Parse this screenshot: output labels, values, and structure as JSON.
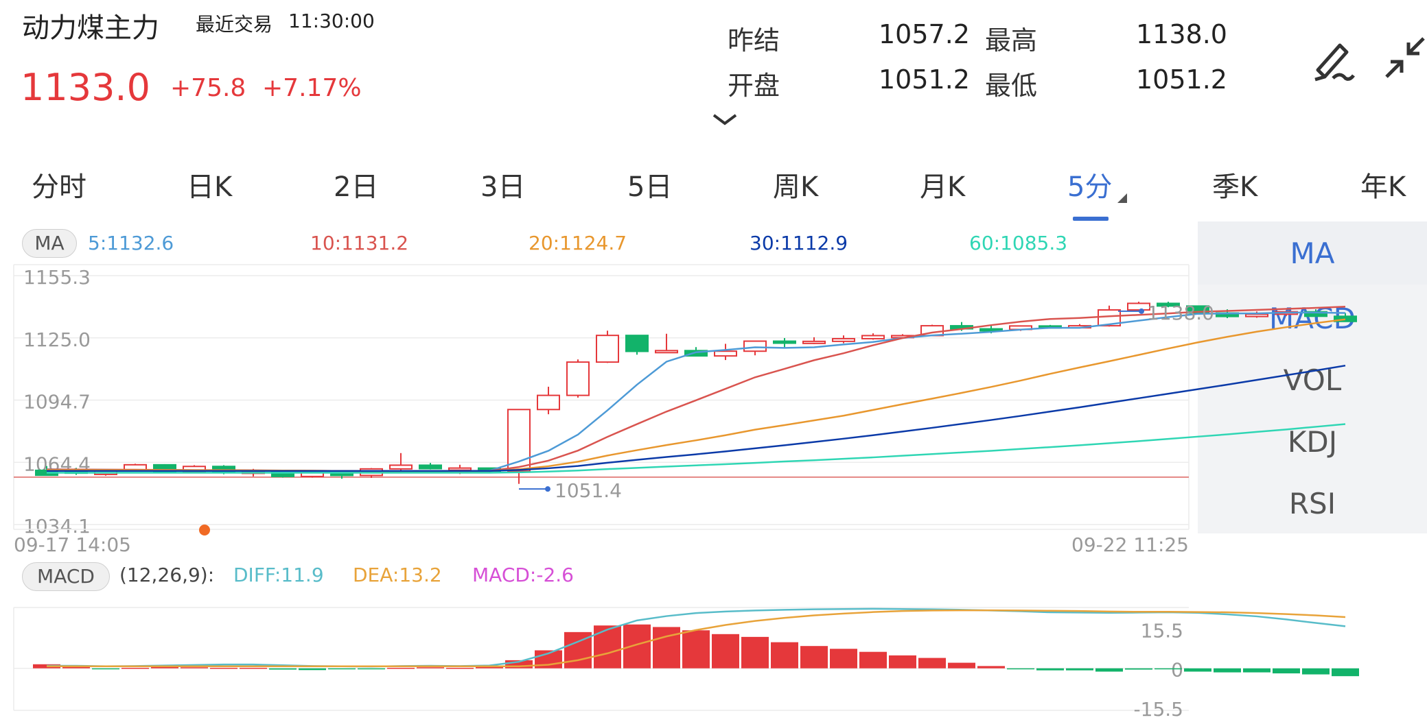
{
  "header": {
    "name": "动力煤主力",
    "time_label": "最近交易",
    "time": "11:30:00",
    "price": "1133.0",
    "change": "+75.8",
    "change_pct": "+7.17%",
    "stats": [
      {
        "label": "昨结",
        "value": "1057.2"
      },
      {
        "label": "最高",
        "value": "1138.0"
      },
      {
        "label": "开盘",
        "value": "1051.2"
      },
      {
        "label": "最低",
        "value": "1051.2"
      }
    ]
  },
  "icons": {
    "expand": "chevron-down-icon",
    "draw": "pencil-draw-icon",
    "collapse": "collapse-arrows-icon"
  },
  "tabs": [
    {
      "label": "分时"
    },
    {
      "label": "日K"
    },
    {
      "label": "2日"
    },
    {
      "label": "3日"
    },
    {
      "label": "5日"
    },
    {
      "label": "周K"
    },
    {
      "label": "月K"
    },
    {
      "label": "5分",
      "active": true
    },
    {
      "label": "季K"
    },
    {
      "label": "年K"
    }
  ],
  "side": [
    "MA",
    "MACD",
    "VOL",
    "KDJ",
    "RSI"
  ],
  "colors": {
    "up": "#e5383b",
    "down": "#12b36a",
    "ma5": "#4d9ad6",
    "ma10": "#d9544f",
    "ma20": "#e8972e",
    "ma30": "#0b3aa8",
    "ma60": "#2fd6b4",
    "diff": "#58bcc9",
    "dea": "#e8a33a",
    "macd": "#d64fd6",
    "active": "#3a6fd1"
  },
  "ma_legend": {
    "pill": "MA",
    "items": [
      {
        "text": "5:1132.6",
        "color": "#4d9ad6"
      },
      {
        "text": "10:1131.2",
        "color": "#d9544f"
      },
      {
        "text": "20:1124.7",
        "color": "#e8972e"
      },
      {
        "text": "30:1112.9",
        "color": "#0b3aa8"
      },
      {
        "text": "60:1085.3",
        "color": "#2fd6b4"
      }
    ]
  },
  "macd_legend": {
    "pill": "MACD",
    "params": "(12,26,9):",
    "diff": "DIFF:11.9",
    "dea": "DEA:13.2",
    "macd": "MACD:-2.6"
  },
  "chart_data": [
    {
      "type": "candlestick",
      "y_ticks": [
        "1155.3",
        "1125.0",
        "1094.7",
        "1064.4",
        "1034.1"
      ],
      "ylim": [
        1034.1,
        1155.3
      ],
      "x_start_label": "09-17 14:05",
      "x_end_label": "09-22 11:25",
      "max_marker": "1138.0",
      "min_marker": "1051.4",
      "candles": [
        [
          1060.5,
          1062.6,
          1058.8,
          1058.1
        ],
        [
          1060.2,
          1061.7,
          1058.3,
          1059.1
        ],
        [
          1058.5,
          1061,
          1057.9,
          1060.6
        ],
        [
          1060.6,
          1063.7,
          1060.2,
          1063.2
        ],
        [
          1063.2,
          1063.5,
          1059.3,
          1059.7
        ],
        [
          1059.7,
          1063,
          1059.4,
          1062.4
        ],
        [
          1062.4,
          1063,
          1058.6,
          1059.4
        ],
        [
          1059.4,
          1061.2,
          1057.5,
          1060
        ],
        [
          1060,
          1060.3,
          1057,
          1057.5
        ],
        [
          1057.5,
          1060.2,
          1057,
          1059.9
        ],
        [
          1059.9,
          1060.4,
          1056.4,
          1058
        ],
        [
          1058,
          1061.6,
          1056.8,
          1061.2
        ],
        [
          1061.2,
          1068.9,
          1059.5,
          1063
        ],
        [
          1063,
          1064.1,
          1060.9,
          1061.3
        ],
        [
          1061.3,
          1063.2,
          1058.7,
          1061.6
        ],
        [
          1061.6,
          1061.8,
          1059.2,
          1060.1
        ],
        [
          1060.1,
          1085.7,
          1053.9,
          1090.1
        ],
        [
          1090.1,
          1101.2,
          1087.8,
          1097
        ],
        [
          1097,
          1114.5,
          1095.9,
          1113.2
        ],
        [
          1113.2,
          1128.5,
          1112.8,
          1126.2
        ],
        [
          1126.2,
          1125.4,
          1116.8,
          1118.4
        ],
        [
          1118.4,
          1127,
          1117.8,
          1118.8
        ],
        [
          1118.8,
          1120.5,
          1117.6,
          1116.2
        ],
        [
          1116.2,
          1122.1,
          1114.2,
          1118.5
        ],
        [
          1118.5,
          1120.6,
          1116.5,
          1123.4
        ],
        [
          1123.4,
          1124.9,
          1120.1,
          1122.5
        ],
        [
          1122.5,
          1125.3,
          1122,
          1123.3
        ],
        [
          1123.3,
          1126.2,
          1122.4,
          1124.6
        ],
        [
          1124.6,
          1127.2,
          1124.1,
          1126.1
        ],
        [
          1126.1,
          1126.8,
          1124.6,
          1126.1
        ],
        [
          1126.1,
          1131.4,
          1125.9,
          1130.9
        ],
        [
          1130.9,
          1132.7,
          1128.4,
          1129.4
        ],
        [
          1129.4,
          1131.1,
          1127.2,
          1129.1
        ],
        [
          1129.1,
          1131.1,
          1128.4,
          1130.8
        ],
        [
          1130.8,
          1131.3,
          1129.5,
          1130.4
        ],
        [
          1130.4,
          1131.7,
          1129.7,
          1130.9
        ],
        [
          1130.9,
          1140.7,
          1130.5,
          1138.6
        ],
        [
          1138.6,
          1142.6,
          1138.6,
          1141.8
        ],
        [
          1141.8,
          1142.6,
          1139.9,
          1140.5
        ],
        [
          1140.5,
          1138,
          1137.1,
          1137.1
        ],
        [
          1137.1,
          1138.9,
          1134.6,
          1135.4
        ],
        [
          1135.4,
          1137.8,
          1134.8,
          1136.5
        ],
        [
          1136.5,
          1137.9,
          1135.7,
          1137.7
        ],
        [
          1137.7,
          1138.9,
          1135.6,
          1135.5
        ],
        [
          1135.5,
          1137.1,
          1133.9,
          1133
        ]
      ],
      "series": [
        {
          "name": "5",
          "values": [
            1061,
            1060.9,
            1060.8,
            1060.7,
            1060.7,
            1060.6,
            1060.5,
            1060.4,
            1060.1,
            1059.8,
            1059.5,
            1059.6,
            1059.8,
            1059.9,
            1060.2,
            1060.3,
            1064.8,
            1070,
            1077.9,
            1089.7,
            1102.2,
            1113.4,
            1118,
            1119.1,
            1120.4,
            1120.1,
            1120.4,
            1121.8,
            1123,
            1124.9,
            1126.2,
            1127,
            1127.9,
            1129,
            1129.9,
            1129.9,
            1131.6,
            1133.4,
            1135.1,
            1136.7,
            1136.9,
            1136.9,
            1137.3,
            1137.3,
            1137.1
          ]
        },
        {
          "name": "10",
          "values": [
            1060.9,
            1060.9,
            1060.8,
            1060.8,
            1060.7,
            1060.6,
            1060.6,
            1060.5,
            1060.4,
            1060.3,
            1060.2,
            1060.1,
            1060.1,
            1060.2,
            1060.2,
            1060.2,
            1062.1,
            1065.2,
            1070.1,
            1076.8,
            1083,
            1089.1,
            1094.6,
            1100.2,
            1105.8,
            1109.9,
            1114.1,
            1117.5,
            1121.4,
            1124.9,
            1127.6,
            1129.3,
            1131.2,
            1132.9,
            1134.2,
            1134.7,
            1135.5,
            1136.2,
            1136.9,
            1137.7,
            1138.1,
            1138.6,
            1139.1,
            1139.6,
            1140.2
          ]
        },
        {
          "name": "20",
          "values": [
            1060.6,
            1060.6,
            1060.6,
            1060.6,
            1060.6,
            1060.5,
            1060.5,
            1060.4,
            1060.4,
            1060.3,
            1060.2,
            1060.2,
            1060.1,
            1060.1,
            1060.1,
            1060.1,
            1061,
            1062.5,
            1064.7,
            1067.7,
            1070.3,
            1072.8,
            1075.1,
            1077.6,
            1080.3,
            1082.5,
            1084.8,
            1087.1,
            1089.9,
            1092.7,
            1095.4,
            1098.2,
            1101.1,
            1104.2,
            1107.5,
            1110.6,
            1113.6,
            1116.7,
            1119.8,
            1122.8,
            1125.5,
            1128,
            1130.2,
            1132.2,
            1134
          ]
        },
        {
          "name": "30",
          "values": [
            1060.2,
            1060.2,
            1060.2,
            1060.2,
            1060.2,
            1060.2,
            1060.2,
            1060.2,
            1060.2,
            1060.2,
            1060.2,
            1060.2,
            1060.2,
            1060.2,
            1060.2,
            1060.2,
            1060.7,
            1061.5,
            1062.6,
            1064.2,
            1065.6,
            1067,
            1068.3,
            1069.7,
            1071.2,
            1072.7,
            1074.3,
            1075.9,
            1077.6,
            1079.4,
            1081.2,
            1083.1,
            1085,
            1087,
            1089.1,
            1091.2,
            1093.4,
            1095.6,
            1097.8,
            1100,
            1102.2,
            1104.5,
            1106.8,
            1109.1,
            1111.5
          ]
        },
        {
          "name": "60",
          "values": [
            1059.3,
            1059.3,
            1059.3,
            1059.3,
            1059.3,
            1059.3,
            1059.3,
            1059.3,
            1059.3,
            1059.3,
            1059.3,
            1059.3,
            1059.3,
            1059.3,
            1059.3,
            1059.3,
            1059.5,
            1059.9,
            1060.4,
            1061.1,
            1061.7,
            1062.3,
            1062.9,
            1063.5,
            1064.1,
            1064.8,
            1065.4,
            1066.1,
            1066.8,
            1067.6,
            1068.4,
            1069.2,
            1070,
            1070.9,
            1071.8,
            1072.7,
            1073.7,
            1074.7,
            1075.8,
            1076.9,
            1078,
            1079.2,
            1080.4,
            1081.7,
            1083
          ]
        }
      ]
    },
    {
      "type": "macd",
      "y_ticks": [
        "15.5",
        "0",
        "-15.5"
      ],
      "ylim": [
        -15.5,
        24
      ],
      "bars": [
        1.6,
        0.7,
        -0.2,
        0.2,
        0.7,
        0.4,
        0.2,
        0.2,
        -0.5,
        -0.7,
        -0.4,
        -0.4,
        0.2,
        0.4,
        0.2,
        0.7,
        3.2,
        7.1,
        14.3,
        16.9,
        17.3,
        16.3,
        15,
        13.5,
        12.4,
        10.3,
        8.8,
        7.7,
        6.5,
        5.1,
        4.1,
        2.2,
        0.9,
        -0.3,
        -0.8,
        -0.8,
        -1.3,
        -0.5,
        -0.2,
        -1.3,
        -1.6,
        -1.6,
        -2,
        -2.4,
        -3.1
      ],
      "diff": [
        1,
        1,
        0.8,
        0.9,
        1.1,
        1.3,
        1.5,
        1.5,
        1.2,
        0.9,
        0.8,
        0.7,
        0.9,
        1,
        0.9,
        1.1,
        2.6,
        5.9,
        10.5,
        15.3,
        18.9,
        20.6,
        21.8,
        22.4,
        22.8,
        23.1,
        23.3,
        23.4,
        23.5,
        23.4,
        23.3,
        23.1,
        22.8,
        22.5,
        22.1,
        22,
        21.9,
        22,
        22.1,
        21.9,
        21.3,
        20.5,
        19.3,
        17.9,
        16.6
      ],
      "dea": [
        0.8,
        0.8,
        0.8,
        0.8,
        0.8,
        0.8,
        0.8,
        0.8,
        0.8,
        0.8,
        0.8,
        0.8,
        0.8,
        0.8,
        0.8,
        0.8,
        0.8,
        1.4,
        3.2,
        5.9,
        9.4,
        12.6,
        15.1,
        17.1,
        18.7,
        19.9,
        20.9,
        21.6,
        22.2,
        22.6,
        22.8,
        22.9,
        22.9,
        22.8,
        22.7,
        22.6,
        22.4,
        22.3,
        22.3,
        22.2,
        22.1,
        21.8,
        21.4,
        20.9,
        20.2
      ]
    }
  ]
}
